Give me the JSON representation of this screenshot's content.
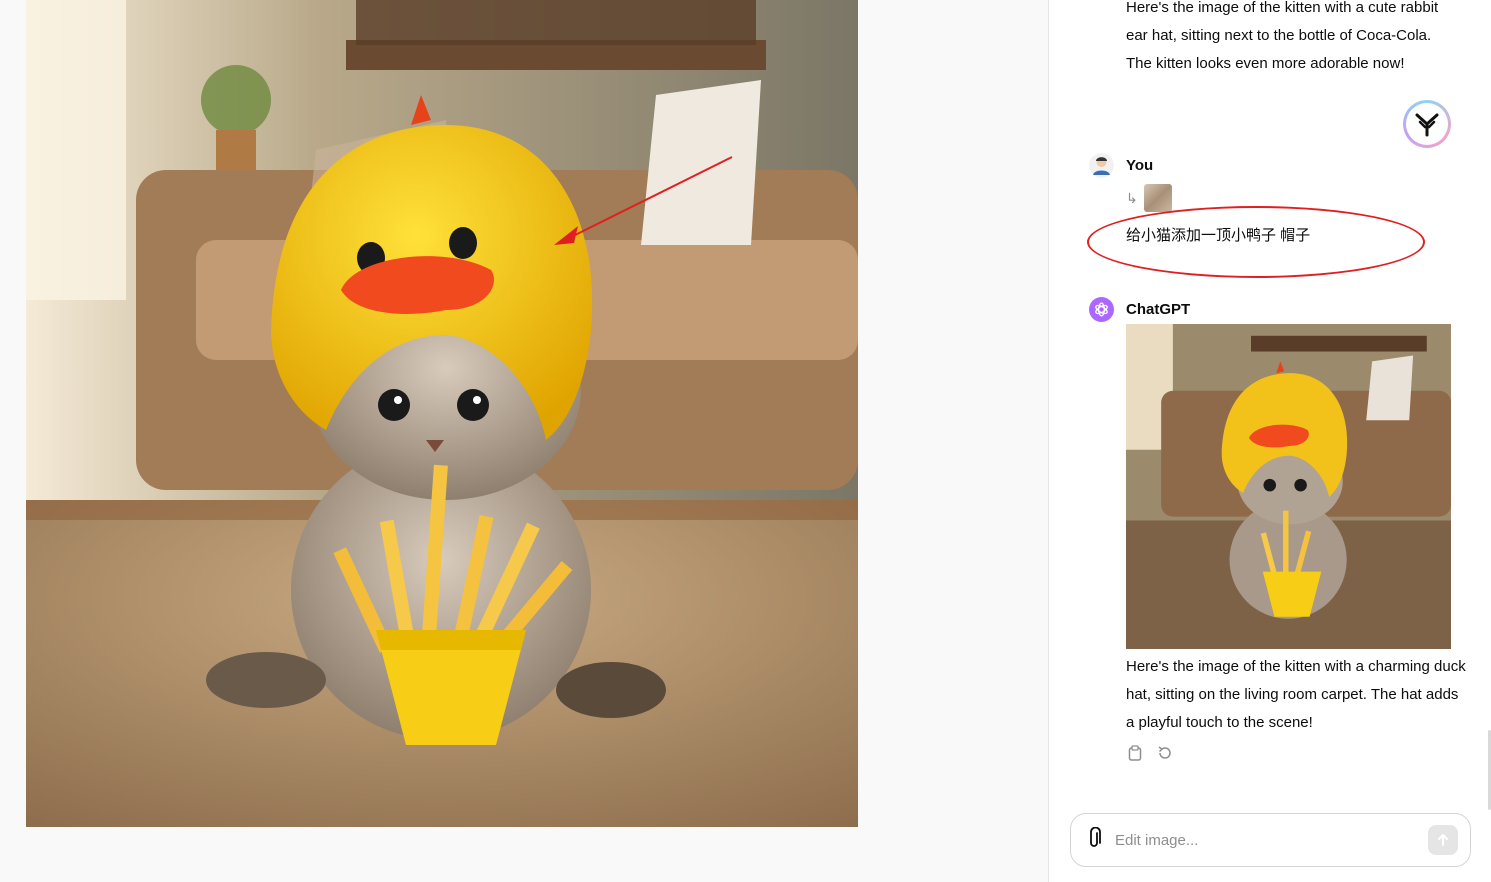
{
  "viewer": {
    "main_image_subject": "kitten-duck-hat-fries"
  },
  "chat": {
    "previous_assistant_message": "Here's the image of the kitten with a cute rabbit ear hat, sitting next to the bottle of Coca-Cola. The kitten looks even more adorable now!",
    "user": {
      "name": "You",
      "reply_arrow": "↳",
      "message": "给小猫添加一顶小鸭子 帽子"
    },
    "assistant": {
      "name": "ChatGPT",
      "message": "Here's the image of the kitten with a charming duck hat, sitting on the living room carpet. The hat adds a playful touch to the scene!"
    },
    "actions": {
      "copy_icon": "clipboard-icon",
      "regenerate_icon": "refresh-icon"
    },
    "composer": {
      "placeholder": "Edit image..."
    }
  },
  "colors": {
    "annotation_red": "#e02020",
    "chatgpt_purple": "#ab68ff",
    "duck_yellow": "#f5c518",
    "beak_orange": "#f04a1e"
  }
}
